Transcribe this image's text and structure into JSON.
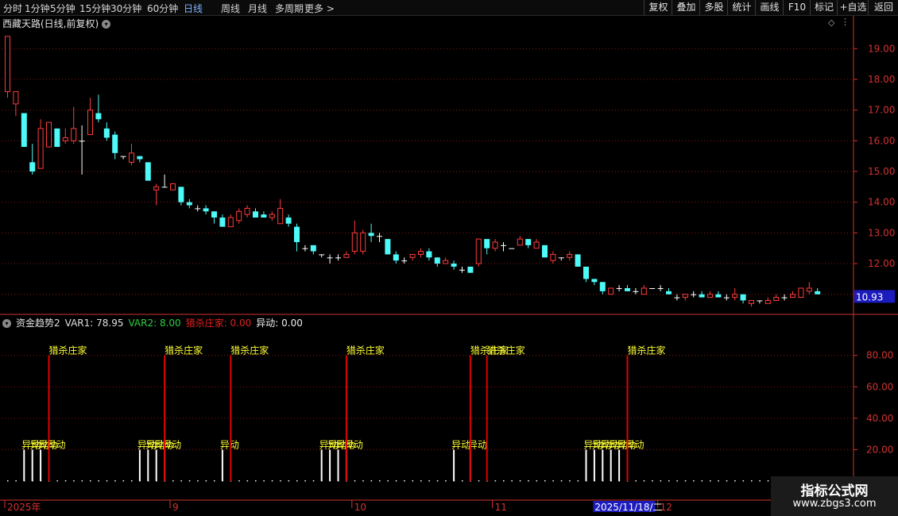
{
  "toolbar": {
    "left_tabs": [
      {
        "label": "分时",
        "active": false
      },
      {
        "label": "1分钟",
        "active": false
      },
      {
        "label": "5分钟",
        "active": false
      },
      {
        "label": "15分钟",
        "active": false
      },
      {
        "label": "30分钟",
        "active": false
      },
      {
        "label": "60分钟",
        "active": false
      },
      {
        "label": "日线",
        "active": true
      },
      {
        "label": "周线",
        "active": false
      },
      {
        "label": "月线",
        "active": false
      },
      {
        "label": "多周期",
        "active": false
      },
      {
        "label": "更多 >",
        "active": false
      }
    ],
    "right_buttons": [
      "复权",
      "叠加",
      "多股",
      "统计",
      "画线",
      "F10",
      "标记",
      "+自选",
      "返回"
    ]
  },
  "main_chart": {
    "title": "西藏天路(日线,前复权)",
    "price_axis": [
      "19.00",
      "18.00",
      "17.00",
      "16.00",
      "15.00",
      "14.00",
      "13.00",
      "12.00",
      "11.00"
    ],
    "price_range": [
      10.45,
      19.55
    ],
    "current_price": "10.93",
    "colors": {
      "up": "#ff3b3b",
      "down": "#4dfaf8",
      "flat": "#ffffff",
      "grid": "#8a1515",
      "axis": "#d23232",
      "price_tag": "#1c1cbe"
    },
    "candles": [
      [
        17.6,
        19.4,
        17.4,
        19.4
      ],
      [
        17.2,
        17.6,
        16.8,
        17.6
      ],
      [
        16.9,
        15.8,
        15.8,
        16.9
      ],
      [
        15.3,
        15.0,
        14.9,
        15.9
      ],
      [
        15.1,
        16.4,
        15.1,
        16.7
      ],
      [
        15.8,
        16.6,
        15.8,
        16.6
      ],
      [
        16.4,
        15.8,
        15.8,
        16.4
      ],
      [
        16.0,
        16.1,
        15.9,
        16.4
      ],
      [
        16.0,
        16.4,
        15.9,
        17.1
      ],
      [
        16.0,
        16.0,
        14.9,
        16.5
      ],
      [
        16.2,
        17.0,
        16.2,
        17.4
      ],
      [
        16.9,
        16.7,
        16.6,
        17.5
      ],
      [
        16.4,
        16.1,
        16.0,
        16.6
      ],
      [
        16.2,
        15.6,
        15.4,
        16.3
      ],
      [
        15.5,
        15.5,
        15.4,
        15.5
      ],
      [
        15.3,
        15.6,
        15.2,
        15.9
      ],
      [
        15.5,
        15.4,
        15.3,
        15.5
      ],
      [
        15.3,
        14.7,
        14.7,
        15.3
      ],
      [
        14.4,
        14.5,
        13.9,
        14.6
      ],
      [
        14.5,
        14.5,
        14.5,
        14.9
      ],
      [
        14.4,
        14.6,
        14.4,
        14.6
      ],
      [
        14.5,
        14.0,
        13.9,
        14.5
      ],
      [
        14.0,
        13.9,
        13.8,
        14.1
      ],
      [
        13.8,
        13.8,
        13.7,
        13.9
      ],
      [
        13.8,
        13.7,
        13.6,
        13.9
      ],
      [
        13.7,
        13.5,
        13.3,
        13.7
      ],
      [
        13.5,
        13.2,
        13.2,
        13.6
      ],
      [
        13.2,
        13.5,
        13.2,
        13.6
      ],
      [
        13.4,
        13.7,
        13.3,
        13.8
      ],
      [
        13.6,
        13.8,
        13.5,
        13.9
      ],
      [
        13.7,
        13.5,
        13.5,
        13.8
      ],
      [
        13.6,
        13.5,
        13.5,
        13.7
      ],
      [
        13.5,
        13.6,
        13.4,
        13.7
      ],
      [
        13.3,
        13.8,
        13.3,
        14.1
      ],
      [
        13.5,
        13.3,
        13.2,
        13.6
      ],
      [
        13.2,
        12.7,
        12.4,
        13.3
      ],
      [
        12.5,
        12.5,
        12.4,
        12.6
      ],
      [
        12.6,
        12.4,
        12.3,
        12.6
      ],
      [
        12.3,
        12.3,
        12.2,
        12.3
      ],
      [
        12.2,
        12.2,
        12.0,
        12.3
      ],
      [
        12.2,
        12.2,
        12.1,
        12.3
      ],
      [
        12.2,
        12.3,
        12.2,
        12.4
      ],
      [
        12.4,
        13.0,
        12.3,
        13.4
      ],
      [
        12.4,
        13.0,
        12.3,
        13.1
      ],
      [
        13.0,
        12.9,
        12.7,
        13.3
      ],
      [
        12.9,
        12.9,
        12.7,
        13.0
      ],
      [
        12.8,
        12.3,
        12.3,
        12.8
      ],
      [
        12.3,
        12.1,
        12.0,
        12.4
      ],
      [
        12.1,
        12.1,
        12.0,
        12.2
      ],
      [
        12.2,
        12.3,
        12.1,
        12.3
      ],
      [
        12.3,
        12.4,
        12.2,
        12.5
      ],
      [
        12.4,
        12.2,
        12.1,
        12.5
      ],
      [
        12.2,
        12.0,
        11.9,
        12.2
      ],
      [
        12.0,
        12.1,
        12.0,
        12.2
      ],
      [
        12.0,
        11.9,
        11.8,
        12.1
      ],
      [
        11.8,
        11.8,
        11.7,
        11.9
      ],
      [
        11.9,
        11.7,
        11.7,
        11.9
      ],
      [
        12.0,
        12.8,
        11.9,
        12.8
      ],
      [
        12.8,
        12.5,
        12.3,
        12.8
      ],
      [
        12.5,
        12.7,
        12.4,
        12.8
      ],
      [
        12.6,
        12.6,
        12.4,
        12.7
      ],
      [
        12.5,
        12.5,
        12.5,
        12.5
      ],
      [
        12.6,
        12.8,
        12.6,
        12.9
      ],
      [
        12.8,
        12.6,
        12.5,
        12.8
      ],
      [
        12.5,
        12.7,
        12.5,
        12.8
      ],
      [
        12.6,
        12.2,
        12.2,
        12.6
      ],
      [
        12.1,
        12.3,
        12.0,
        12.4
      ],
      [
        12.2,
        12.2,
        12.1,
        12.2
      ],
      [
        12.2,
        12.3,
        12.1,
        12.4
      ],
      [
        12.3,
        11.9,
        11.9,
        12.3
      ],
      [
        11.9,
        11.5,
        11.4,
        11.9
      ],
      [
        11.5,
        11.4,
        11.3,
        11.5
      ],
      [
        11.4,
        11.1,
        11.0,
        11.4
      ],
      [
        11.0,
        11.2,
        11.0,
        11.2
      ],
      [
        11.2,
        11.2,
        11.1,
        11.3
      ],
      [
        11.2,
        11.1,
        11.1,
        11.3
      ],
      [
        11.1,
        11.1,
        11.0,
        11.2
      ],
      [
        11.0,
        11.2,
        11.0,
        11.3
      ],
      [
        11.2,
        11.2,
        11.2,
        11.2
      ],
      [
        11.2,
        11.2,
        11.1,
        11.3
      ],
      [
        11.1,
        11.0,
        11.0,
        11.2
      ],
      [
        10.9,
        10.9,
        10.8,
        11.0
      ],
      [
        10.9,
        11.0,
        10.8,
        11.0
      ],
      [
        11.0,
        11.0,
        10.9,
        11.1
      ],
      [
        11.0,
        10.9,
        10.9,
        11.1
      ],
      [
        10.9,
        11.0,
        10.9,
        11.1
      ],
      [
        11.0,
        10.9,
        10.9,
        11.1
      ],
      [
        10.9,
        10.9,
        10.8,
        11.0
      ],
      [
        10.9,
        11.0,
        10.8,
        11.2
      ],
      [
        11.0,
        10.8,
        10.7,
        11.0
      ],
      [
        10.7,
        10.8,
        10.6,
        10.8
      ],
      [
        10.8,
        10.8,
        10.7,
        10.8
      ],
      [
        10.7,
        10.8,
        10.7,
        10.9
      ],
      [
        10.8,
        10.9,
        10.8,
        11.0
      ],
      [
        10.9,
        10.9,
        10.8,
        11.0
      ],
      [
        10.9,
        11.0,
        10.9,
        11.1
      ],
      [
        10.9,
        11.2,
        10.9,
        11.2
      ],
      [
        11.1,
        11.2,
        11.0,
        11.4
      ],
      [
        11.1,
        11.0,
        11.0,
        11.2
      ]
    ]
  },
  "indicator": {
    "name": "资金趋势2",
    "var1": "VAR1: 78.95",
    "var2": "VAR2: 8.00",
    "kill": "猎杀庄家: 0.00",
    "yidong": "异动: 0.00",
    "axis": [
      "80.00",
      "60.00",
      "40.00",
      "20.00"
    ],
    "axis_values": [
      80,
      60,
      40,
      20
    ],
    "range": [
      0,
      96
    ],
    "label_kill": "猎杀庄家",
    "label_yidong": "异动",
    "kill_bars": [
      5,
      19,
      27,
      41,
      56,
      58,
      75
    ],
    "yidong_bars": [
      2,
      3,
      4,
      5,
      16,
      17,
      18,
      19,
      26,
      38,
      39,
      40,
      41,
      54,
      56,
      70,
      71,
      72,
      73,
      74,
      75
    ],
    "yidong_value": 20,
    "kill_value": 80,
    "base_dots_value": 0
  },
  "date_axis": {
    "labels": [
      {
        "text": "2025年",
        "bar": 0
      },
      {
        "text": "9",
        "bar": 20
      },
      {
        "text": "10",
        "bar": 42
      },
      {
        "text": "11",
        "bar": 59
      },
      {
        "text": "12",
        "bar": 79
      }
    ],
    "cursor_date": "2025/11/18/二",
    "cursor_bar": 71
  },
  "watermark": {
    "line1": "指标公式网",
    "line2": "www.zbgs3.com"
  }
}
